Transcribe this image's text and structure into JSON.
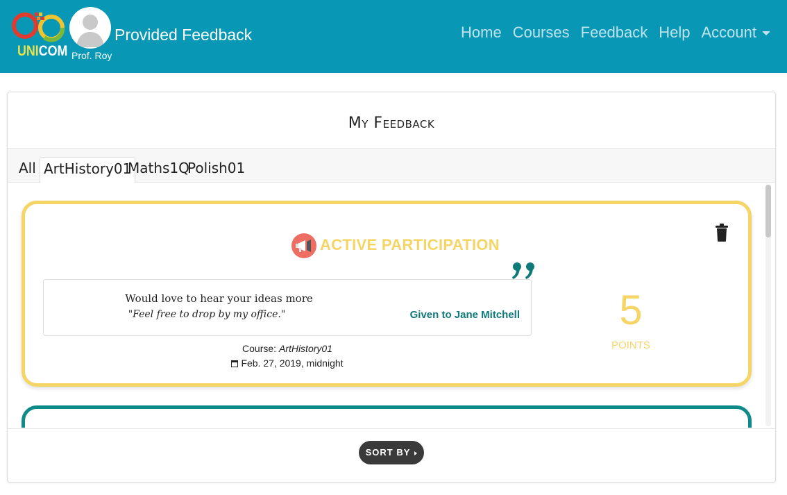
{
  "header": {
    "logo_text_u": "UNI",
    "logo_text_c": "COM",
    "page_title": "Provided Feedback",
    "user_name": "Prof. Roy",
    "nav": [
      "Home",
      "Courses",
      "Feedback",
      "Help",
      "Account"
    ]
  },
  "card": {
    "title": "My Feedback",
    "tabs": [
      "All",
      "ArtHistory01",
      "Maths1Q",
      "Polish01"
    ],
    "active_tab": "ArtHistory01"
  },
  "feedback": {
    "category": "ACTIVE PARTICIPATION",
    "line1": "Would love to hear your ideas more",
    "line2": "\"Feel free to drop by my office.\"",
    "given_to": "Given to Jane Mitchell",
    "course_label": "Course:",
    "course_name": "ArtHistory01",
    "date": "Feb. 27, 2019, midnight",
    "points": "5",
    "points_label": "POINTS"
  },
  "footer": {
    "sort_label": "SORT BY"
  },
  "colors": {
    "header_bg": "#0898b5",
    "accent_yellow": "#f5d565",
    "accent_teal": "#0f7a7a",
    "icon_red": "#ee6e64"
  },
  "icons": [
    "unicom-logo",
    "avatar-icon",
    "dropdown-caret-icon",
    "trash-icon",
    "megaphone-icon",
    "quote-icon",
    "calendar-icon",
    "annotation-arrow-icon"
  ]
}
